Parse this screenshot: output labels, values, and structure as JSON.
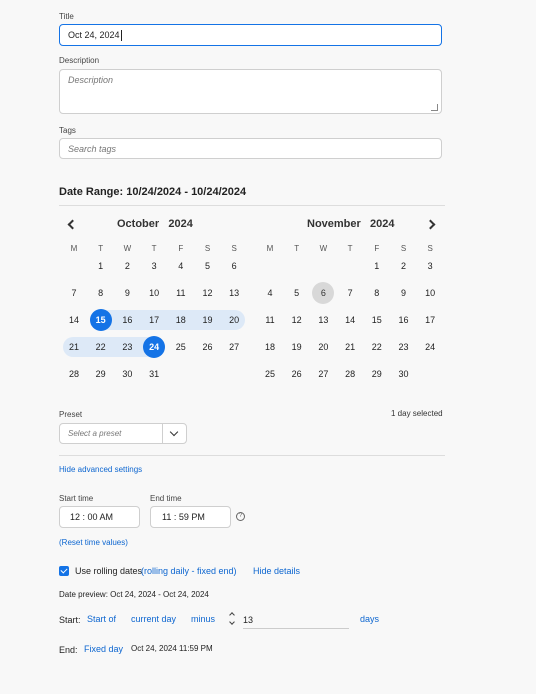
{
  "form": {
    "title_label": "Title",
    "title_value": "Oct 24, 2024",
    "description_label": "Description",
    "description_placeholder": "Description",
    "tags_label": "Tags",
    "tags_placeholder": "Search tags"
  },
  "date_range": {
    "heading": "Date Range: 10/24/2024 - 10/24/2024"
  },
  "calendar": {
    "weekday_headers": [
      "M",
      "T",
      "W",
      "T",
      "F",
      "S",
      "S"
    ],
    "left": {
      "month": "October",
      "year": "2024",
      "weeks": [
        [
          "",
          "1",
          "2",
          "3",
          "4",
          "5",
          "6"
        ],
        [
          "7",
          "8",
          "9",
          "10",
          "11",
          "12",
          "13"
        ],
        [
          "14",
          "15",
          "16",
          "17",
          "18",
          "19",
          "20"
        ],
        [
          "21",
          "22",
          "23",
          "24",
          "25",
          "26",
          "27"
        ],
        [
          "28",
          "29",
          "30",
          "31",
          "",
          "",
          ""
        ]
      ],
      "range_start": "15",
      "range_end": "24"
    },
    "right": {
      "month": "November",
      "year": "2024",
      "weeks": [
        [
          "",
          "",
          "",
          "",
          "1",
          "2",
          "3"
        ],
        [
          "4",
          "5",
          "6",
          "7",
          "8",
          "9",
          "10"
        ],
        [
          "11",
          "12",
          "13",
          "14",
          "15",
          "16",
          "17"
        ],
        [
          "18",
          "19",
          "20",
          "21",
          "22",
          "23",
          "24"
        ],
        [
          "25",
          "26",
          "27",
          "28",
          "29",
          "30",
          ""
        ]
      ],
      "today": "6"
    }
  },
  "preset": {
    "label": "Preset",
    "placeholder": "Select a preset",
    "selection_count": "1 day selected"
  },
  "advanced": {
    "hide_link": "Hide advanced settings",
    "start_time_label": "Start time",
    "start_time": "12 : 00  AM",
    "end_time_label": "End time",
    "end_time": "11 : 59  PM",
    "reset_link": "(Reset time values)"
  },
  "rolling": {
    "checkbox_label": "Use rolling dates",
    "mode_link": "(rolling daily - fixed end)",
    "hide_details": "Hide details",
    "preview": "Date preview: Oct 24, 2024 - Oct 24, 2024",
    "start_label": "Start:",
    "start_of": "Start of",
    "current_day": "current day",
    "minus": "minus",
    "offset_value": "13",
    "days": "days",
    "end_label": "End:",
    "end_mode": "Fixed day",
    "end_value": "Oct 24, 2024 11:59 PM"
  },
  "colors": {
    "accent": "#1473e6",
    "range_band": "#dde9f7",
    "link": "#0d66d0"
  }
}
